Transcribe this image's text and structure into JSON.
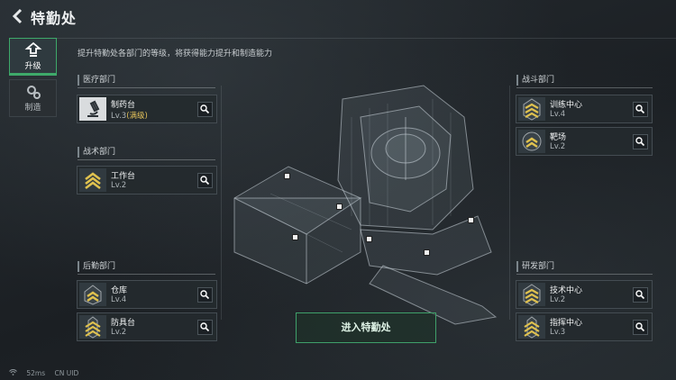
{
  "header": {
    "title": "特勤处"
  },
  "tabs": [
    {
      "label": "升级",
      "active": true
    },
    {
      "label": "制造",
      "active": false
    }
  ],
  "description": "提升特勤处各部门的等级，将获得能力提升和制造能力",
  "sections": {
    "medical": {
      "title": "医疗部门",
      "items": [
        {
          "name": "制药台",
          "level": "Lv.3",
          "badge": "(满级)"
        }
      ]
    },
    "tactical": {
      "title": "战术部门",
      "items": [
        {
          "name": "工作台",
          "level": "Lv.2"
        }
      ]
    },
    "logistics": {
      "title": "后勤部门",
      "items": [
        {
          "name": "仓库",
          "level": "Lv.4"
        },
        {
          "name": "防具台",
          "level": "Lv.2"
        }
      ]
    },
    "combat": {
      "title": "战斗部门",
      "items": [
        {
          "name": "训练中心",
          "level": "Lv.4"
        },
        {
          "name": "靶场",
          "level": "Lv.2"
        }
      ]
    },
    "research": {
      "title": "研发部门",
      "items": [
        {
          "name": "技术中心",
          "level": "Lv.2"
        },
        {
          "name": "指挥中心",
          "level": "Lv.3"
        }
      ]
    }
  },
  "enter_button": "进入特勤处",
  "status_bar": {
    "ping": "52ms",
    "uid_label": "CN UID"
  },
  "colors": {
    "accent": "#3ea96a",
    "max_level": "#e3c15a"
  }
}
